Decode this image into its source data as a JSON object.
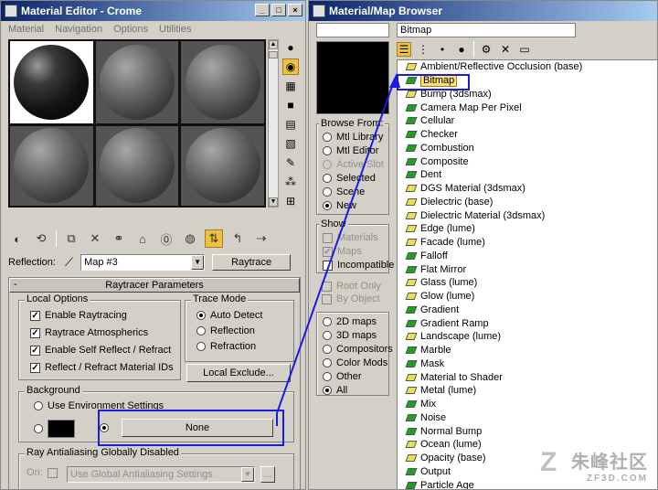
{
  "mat_editor": {
    "title": "Material Editor - Crome",
    "menu": [
      "Material",
      "Navigation",
      "Options",
      "Utilities"
    ],
    "reflection_label": "Reflection:",
    "map_name": "Map #3",
    "map_type": "Raytrace",
    "rollout_title": "Raytracer Parameters",
    "rollout_minus": "-",
    "local_options": {
      "label": "Local Options",
      "items": [
        "Enable Raytracing",
        "Raytrace Atmospherics",
        "Enable Self Reflect / Refract",
        "Reflect / Refract Material IDs"
      ]
    },
    "trace_mode": {
      "label": "Trace Mode",
      "items": [
        "Auto Detect",
        "Reflection",
        "Refraction"
      ]
    },
    "local_exclude": "Local Exclude...",
    "background": {
      "label": "Background",
      "use_env": "Use Environment Settings",
      "none_button": "None"
    },
    "antialias": {
      "label": "Ray Antialiasing Globally Disabled",
      "on_label": "On:",
      "setting": "Use Global Antialiasing Settings",
      "dots": "..."
    }
  },
  "browser": {
    "title": "Material/Map Browser",
    "search_value": "Bitmap",
    "browse_from": {
      "label": "Browse From:",
      "items": [
        "Mtl Library",
        "Mtl Editor",
        "Active Slot",
        "Selected",
        "Scene",
        "New"
      ]
    },
    "show": {
      "label": "Show",
      "items": [
        "Materials",
        "Maps",
        "Incompatible"
      ]
    },
    "root_only": "Root Only",
    "by_object": "By Object",
    "map_types": [
      "2D maps",
      "3D maps",
      "Compositors",
      "Color Mods",
      "Other",
      "All"
    ],
    "list": [
      {
        "name": "Ambient/Reflective Occlusion (base)",
        "icon": "y"
      },
      {
        "name": "Bitmap",
        "icon": "g"
      },
      {
        "name": "Bump (3dsmax)",
        "icon": "y"
      },
      {
        "name": "Camera Map Per Pixel",
        "icon": "g"
      },
      {
        "name": "Cellular",
        "icon": "g"
      },
      {
        "name": "Checker",
        "icon": "g"
      },
      {
        "name": "Combustion",
        "icon": "g"
      },
      {
        "name": "Composite",
        "icon": "g"
      },
      {
        "name": "Dent",
        "icon": "g"
      },
      {
        "name": "DGS Material (3dsmax)",
        "icon": "y"
      },
      {
        "name": "Dielectric (base)",
        "icon": "y"
      },
      {
        "name": "Dielectric Material (3dsmax)",
        "icon": "y"
      },
      {
        "name": "Edge (lume)",
        "icon": "y"
      },
      {
        "name": "Facade (lume)",
        "icon": "y"
      },
      {
        "name": "Falloff",
        "icon": "g"
      },
      {
        "name": "Flat Mirror",
        "icon": "g"
      },
      {
        "name": "Glass (lume)",
        "icon": "y"
      },
      {
        "name": "Glow (lume)",
        "icon": "y"
      },
      {
        "name": "Gradient",
        "icon": "g"
      },
      {
        "name": "Gradient Ramp",
        "icon": "g"
      },
      {
        "name": "Landscape (lume)",
        "icon": "y"
      },
      {
        "name": "Marble",
        "icon": "g"
      },
      {
        "name": "Mask",
        "icon": "g"
      },
      {
        "name": "Material to Shader",
        "icon": "y"
      },
      {
        "name": "Metal (lume)",
        "icon": "y"
      },
      {
        "name": "Mix",
        "icon": "g"
      },
      {
        "name": "Noise",
        "icon": "g"
      },
      {
        "name": "Normal Bump",
        "icon": "g"
      },
      {
        "name": "Ocean (lume)",
        "icon": "y"
      },
      {
        "name": "Opacity (base)",
        "icon": "y"
      },
      {
        "name": "Output",
        "icon": "g"
      },
      {
        "name": "Particle Age",
        "icon": "g"
      }
    ]
  },
  "watermark": {
    "line1": "朱峰社区",
    "line2": "ZF3D.COM"
  },
  "colors": {
    "highlight": "#1a1ae0",
    "titlebar": "#0a246a"
  }
}
